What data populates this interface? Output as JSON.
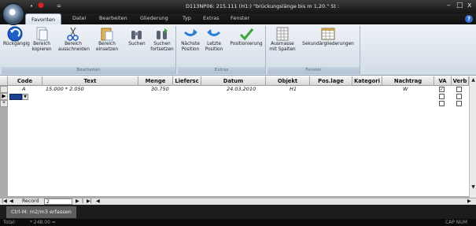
{
  "window": {
    "title": "D113NP06: 215.111  (H1:) \"brückungslänge bis m 1,20.\" St :",
    "minimize": "–",
    "maximize": "□",
    "close": "x"
  },
  "quick_access": {
    "item1": "•",
    "item2": "●",
    "item3": "="
  },
  "tabs": [
    {
      "label": "Favoriten"
    },
    {
      "label": "Datei"
    },
    {
      "label": "Bearbeiten"
    },
    {
      "label": "Gliederung"
    },
    {
      "label": "Typ"
    },
    {
      "label": "Extras"
    },
    {
      "label": "Fenster"
    }
  ],
  "help_label": "?",
  "ribbon": {
    "groups": [
      {
        "label": "Bearbeiten"
      },
      {
        "label": "Extras"
      },
      {
        "label": "Fenster"
      }
    ],
    "buttons": [
      {
        "line1": "Rückgängig",
        "line2": ""
      },
      {
        "line1": "Bereich",
        "line2": "kopieren"
      },
      {
        "line1": "Bereich",
        "line2": "ausschneiden"
      },
      {
        "line1": "Bereich",
        "line2": "einsetzen"
      },
      {
        "line1": "Suchen",
        "line2": ""
      },
      {
        "line1": "Suchen",
        "line2": "fortsetzen"
      },
      {
        "line1": "Nächste",
        "line2": "Position"
      },
      {
        "line1": "Letzte",
        "line2": "Position"
      },
      {
        "line1": "Positionierung",
        "line2": ""
      },
      {
        "line1": "Ausmasse",
        "line2": "mit Spalten"
      },
      {
        "line1": "Sekundärgliederungen",
        "line2": ""
      }
    ]
  },
  "grid": {
    "columns": [
      "Code",
      "Text",
      "Menge",
      "Liefersc",
      "Datum",
      "Objekt",
      "Pos.lage",
      "Kategori",
      "Nachtrag",
      "VA",
      "Verb"
    ],
    "rows": [
      {
        "code": "A",
        "text": "15.000 * 2.050",
        "menge": "30.750",
        "datum": "24.03.2010",
        "objekt": "H1",
        "nachtrag": "W",
        "va": "✓",
        "verb": ""
      }
    ],
    "current_row_marker": "▶",
    "new_row_marker": "*",
    "dropdown_arrow": "▼"
  },
  "record_nav": {
    "first": "|◀",
    "prev": "◀",
    "label": "Record",
    "value": "2",
    "next": "▶",
    "next_sep": "|",
    "last": "▶|",
    "scroll_left": "◀",
    "scroll_right": "▶"
  },
  "bottom_tab": {
    "label": "Ctrl-M: m2/m3 erfassen"
  },
  "statusbar": {
    "left": "Total:",
    "mid": "* 248.00 =",
    "right": "CAP NUM"
  }
}
